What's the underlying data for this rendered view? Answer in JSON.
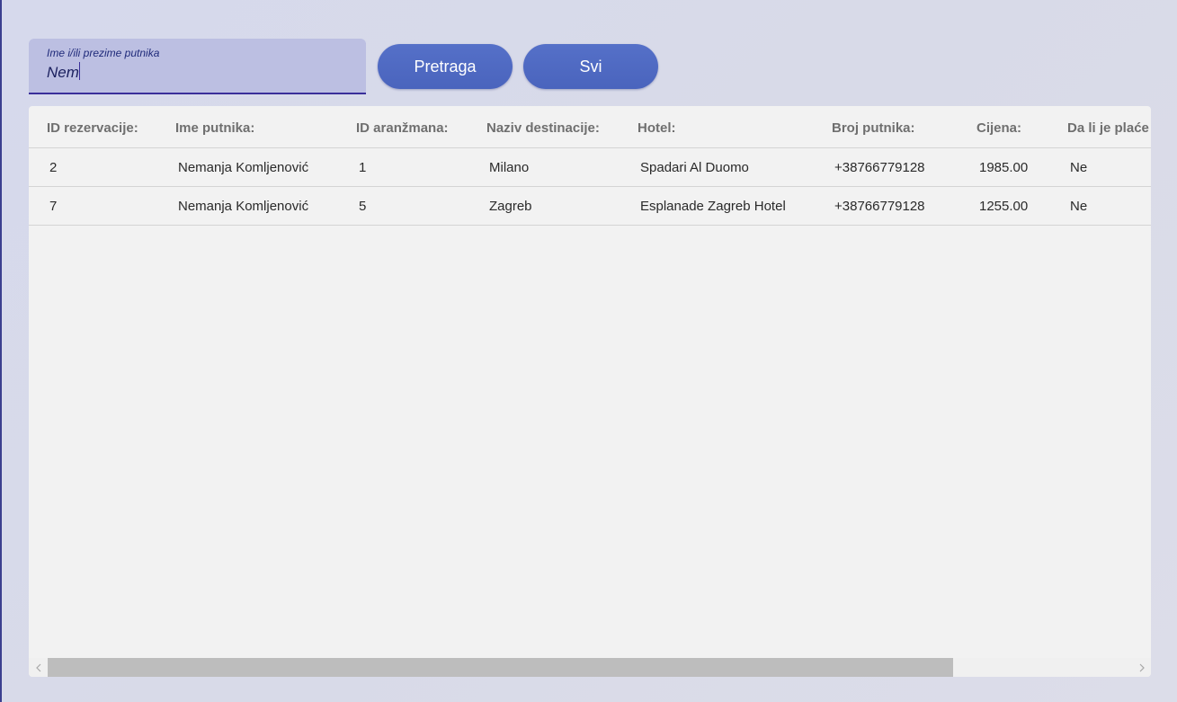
{
  "search": {
    "label": "Ime i/ili prezime putnika",
    "value": "Nem"
  },
  "buttons": {
    "search_label": "Pretraga",
    "all_label": "Svi"
  },
  "table": {
    "headers": [
      "ID rezervacije:",
      "Ime putnika:",
      "ID aranžmana:",
      "Naziv destinacije:",
      "Hotel:",
      "Broj putnika:",
      "Cijena:",
      "Da li je plaće"
    ],
    "rows": [
      [
        "2",
        "Nemanja Komljenović",
        "1",
        "Milano",
        "Spadari Al Duomo",
        "+38766779128",
        "1985.00",
        "Ne"
      ],
      [
        "7",
        "Nemanja Komljenović",
        "5",
        "Zagreb",
        "Esplanade Zagreb Hotel",
        "+38766779128",
        "1255.00",
        "Ne"
      ]
    ]
  },
  "scrollbar": {
    "left_arrow_icon": "chevron-left-icon",
    "right_arrow_icon": "chevron-right-icon"
  },
  "colors": {
    "button": "#5570c8",
    "search_bg": "#bcbfe2",
    "search_underline": "#3a2f9a"
  }
}
